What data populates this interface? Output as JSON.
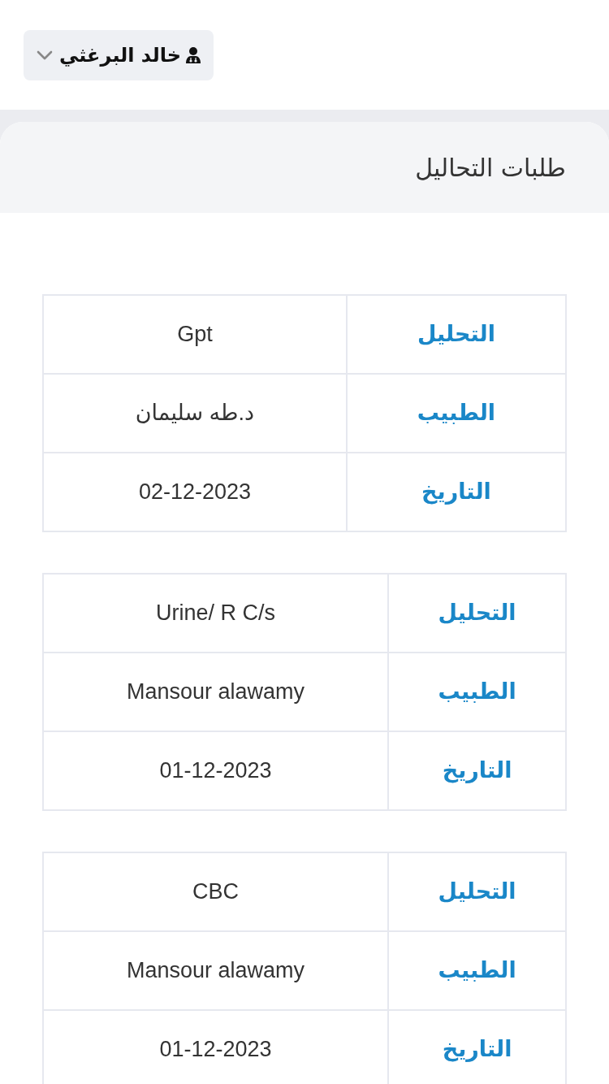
{
  "user_menu": {
    "name": "خالد البرغثي"
  },
  "card": {
    "title": "طلبات التحاليل"
  },
  "requests": [
    {
      "rows": [
        {
          "label": "التحليل",
          "value": "Gpt"
        },
        {
          "label": "الطبيب",
          "value": "د.طه سليمان"
        },
        {
          "label": "التاريخ",
          "value": "02-12-2023"
        }
      ]
    },
    {
      "rows": [
        {
          "label": "التحليل",
          "value": "Urine/ R C/s"
        },
        {
          "label": "الطبيب",
          "value": "Mansour alawamy"
        },
        {
          "label": "التاريخ",
          "value": "01-12-2023"
        }
      ]
    },
    {
      "rows": [
        {
          "label": "التحليل",
          "value": "CBC"
        },
        {
          "label": "الطبيب",
          "value": "Mansour alawamy"
        },
        {
          "label": "التاريخ",
          "value": "01-12-2023"
        }
      ]
    }
  ]
}
